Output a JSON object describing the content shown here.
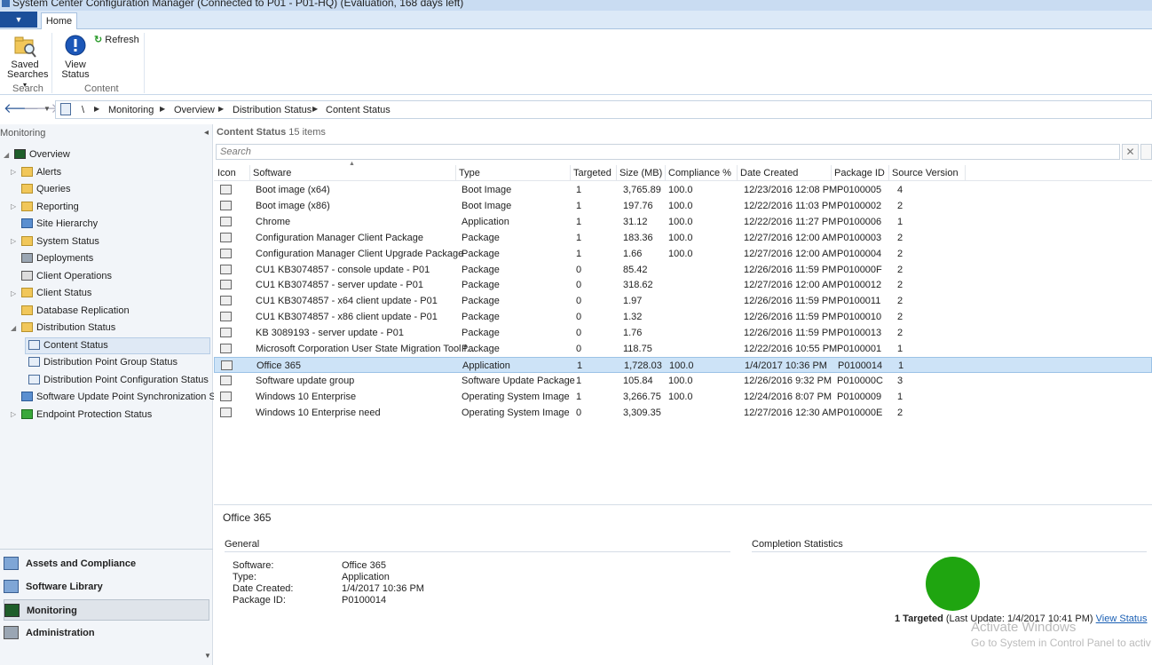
{
  "window": {
    "title": "System Center Configuration Manager (Connected to P01 - P01-HQ) (Evaluation, 168 days left)"
  },
  "ribbon": {
    "tab": "Home",
    "saved_searches": "Saved Searches",
    "saved_searches_arrow": "▾",
    "view_status": "View Status",
    "refresh": "Refresh",
    "group_search": "Search",
    "group_content": "Content"
  },
  "breadcrumb": {
    "root": "\\",
    "items": [
      "Monitoring",
      "Overview",
      "Distribution Status",
      "Content Status"
    ]
  },
  "sidebar": {
    "title": "Monitoring",
    "items": [
      {
        "label": "Overview"
      },
      {
        "label": "Alerts"
      },
      {
        "label": "Queries"
      },
      {
        "label": "Reporting"
      },
      {
        "label": "Site Hierarchy"
      },
      {
        "label": "System Status"
      },
      {
        "label": "Deployments"
      },
      {
        "label": "Client Operations"
      },
      {
        "label": "Client Status"
      },
      {
        "label": "Database Replication"
      },
      {
        "label": "Distribution Status"
      },
      {
        "label": "Content Status"
      },
      {
        "label": "Distribution Point Group Status"
      },
      {
        "label": "Distribution Point Configuration Status"
      },
      {
        "label": "Software Update Point Synchronization Status"
      },
      {
        "label": "Endpoint Protection Status"
      }
    ],
    "workspaces": [
      {
        "label": "Assets and Compliance"
      },
      {
        "label": "Software Library"
      },
      {
        "label": "Monitoring"
      },
      {
        "label": "Administration"
      }
    ]
  },
  "content": {
    "title": "Content Status",
    "count": "15 items",
    "search_placeholder": "Search",
    "clear": "✕",
    "columns": [
      "Icon",
      "Software",
      "Type",
      "Targeted",
      "Size (MB)",
      "Compliance %",
      "Date Created",
      "Package ID",
      "Source Version"
    ],
    "rows": [
      [
        "Boot image (x64)",
        "Boot Image",
        "1",
        "3,765.89",
        "100.0",
        "12/23/2016 12:08 PM",
        "P0100005",
        "4"
      ],
      [
        "Boot image (x86)",
        "Boot Image",
        "1",
        "197.76",
        "100.0",
        "12/22/2016 11:03 PM",
        "P0100002",
        "2"
      ],
      [
        "Chrome",
        "Application",
        "1",
        "31.12",
        "100.0",
        "12/22/2016 11:27 PM",
        "P0100006",
        "1"
      ],
      [
        "Configuration Manager Client Package",
        "Package",
        "1",
        "183.36",
        "100.0",
        "12/27/2016 12:00 AM",
        "P0100003",
        "2"
      ],
      [
        "Configuration Manager Client Upgrade Package",
        "Package",
        "1",
        "1.66",
        "100.0",
        "12/27/2016 12:00 AM",
        "P0100004",
        "2"
      ],
      [
        "CU1 KB3074857 - console update - P01",
        "Package",
        "0",
        "85.42",
        "",
        "12/26/2016 11:59 PM",
        "P010000F",
        "2"
      ],
      [
        "CU1 KB3074857 - server update - P01",
        "Package",
        "0",
        "318.62",
        "",
        "12/27/2016 12:00 AM",
        "P0100012",
        "2"
      ],
      [
        "CU1 KB3074857 - x64 client update - P01",
        "Package",
        "0",
        "1.97",
        "",
        "12/26/2016 11:59 PM",
        "P0100011",
        "2"
      ],
      [
        "CU1 KB3074857 - x86 client update - P01",
        "Package",
        "0",
        "1.32",
        "",
        "12/26/2016 11:59 PM",
        "P0100010",
        "2"
      ],
      [
        "KB 3089193 - server update - P01",
        "Package",
        "0",
        "1.76",
        "",
        "12/26/2016 11:59 PM",
        "P0100013",
        "2"
      ],
      [
        "Microsoft Corporation User State Migration Tool f...",
        "Package",
        "0",
        "118.75",
        "",
        "12/22/2016 10:55 PM",
        "P0100001",
        "1"
      ],
      [
        "Office 365",
        "Application",
        "1",
        "1,728.03",
        "100.0",
        "1/4/2017 10:36 PM",
        "P0100014",
        "1"
      ],
      [
        "Software update group",
        "Software Update Package",
        "1",
        "105.84",
        "100.0",
        "12/26/2016 9:32 PM",
        "P010000C",
        "3"
      ],
      [
        "Windows 10 Enterprise",
        "Operating System Image",
        "1",
        "3,266.75",
        "100.0",
        "12/24/2016 8:07 PM",
        "P0100009",
        "1"
      ],
      [
        "Windows 10 Enterprise need",
        "Operating System Image",
        "0",
        "3,309.35",
        "",
        "12/27/2016 12:30 AM",
        "P010000E",
        "2"
      ]
    ],
    "selected_index": 11
  },
  "details": {
    "title": "Office 365",
    "general": "General",
    "completion": "Completion Statistics",
    "labels": [
      "Software:",
      "Type:",
      "Date Created:",
      "Package ID:"
    ],
    "values": [
      "Office 365",
      "Application",
      "1/4/2017 10:36 PM",
      "P0100014"
    ],
    "targeted": "1 Targeted",
    "last_update": "(Last Update: 1/4/2017 10:41 PM)",
    "view_status": "View Status",
    "pie_color": "#1fa510"
  },
  "watermark": {
    "line1": "Activate Windows",
    "line2": "Go to System in Control Panel to activ"
  }
}
